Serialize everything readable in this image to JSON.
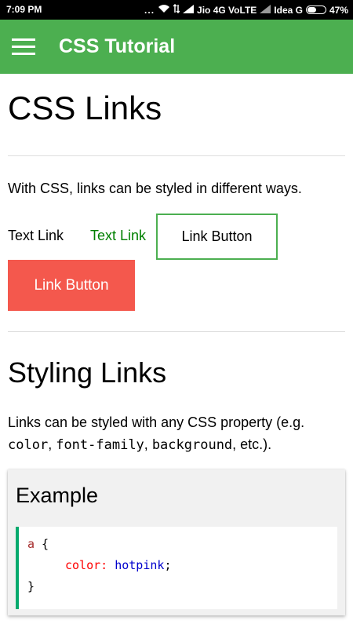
{
  "status_bar": {
    "time": "7:09 PM",
    "dots": "...",
    "carrier1": "Jio 4G VoLTE",
    "carrier2": "Idea G",
    "battery": "47%",
    "battery_level": 0.47
  },
  "app_bar": {
    "title": "CSS Tutorial",
    "color": "#4caf50",
    "menu_icon": "hamburger-menu-icon"
  },
  "page": {
    "title": "CSS Links",
    "intro": "With CSS, links can be styled in different ways.",
    "links": {
      "text_link": "Text Link",
      "text_link_green": "Text Link",
      "link_button_outline": "Link Button",
      "link_button_red": "Link Button"
    },
    "section_title": "Styling Links",
    "desc_prefix": "Links can be styled with any CSS property (e.g. ",
    "desc_code1": "color",
    "desc_sep1": ", ",
    "desc_code2": "font-family",
    "desc_sep2": ", ",
    "desc_code3": "background",
    "desc_suffix": ", etc.).",
    "example": {
      "title": "Example",
      "code": {
        "selector": "a",
        "open_brace": " {",
        "property": "color:",
        "value": " hotpink",
        "semicolon": ";",
        "close_brace": "}"
      }
    }
  },
  "colors": {
    "green_link": "#008000",
    "red_button": "#f4584d",
    "code_border": "#04aa6d"
  }
}
